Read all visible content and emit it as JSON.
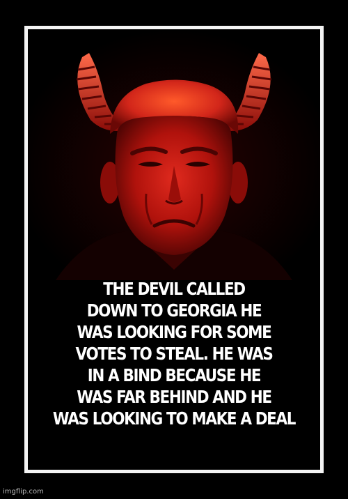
{
  "meme": {
    "lines": [
      "THE DEVIL CALLED",
      "DOWN TO GEORGIA HE",
      "WAS LOOKING FOR SOME",
      "VOTES TO STEAL. HE WAS",
      "IN A BIND BECAUSE HE",
      "WAS FAR BEHIND AND HE",
      "WAS LOOKING TO MAKE A DEAL"
    ]
  },
  "watermark": "imgflip.com",
  "colors": {
    "background": "#000000",
    "frame": "#f4f4f4",
    "text": "#ffffff",
    "face_red": "#c81410",
    "horn_red": "#d0201a"
  },
  "image": {
    "subject": "red-devil-portrait-with-horns"
  }
}
